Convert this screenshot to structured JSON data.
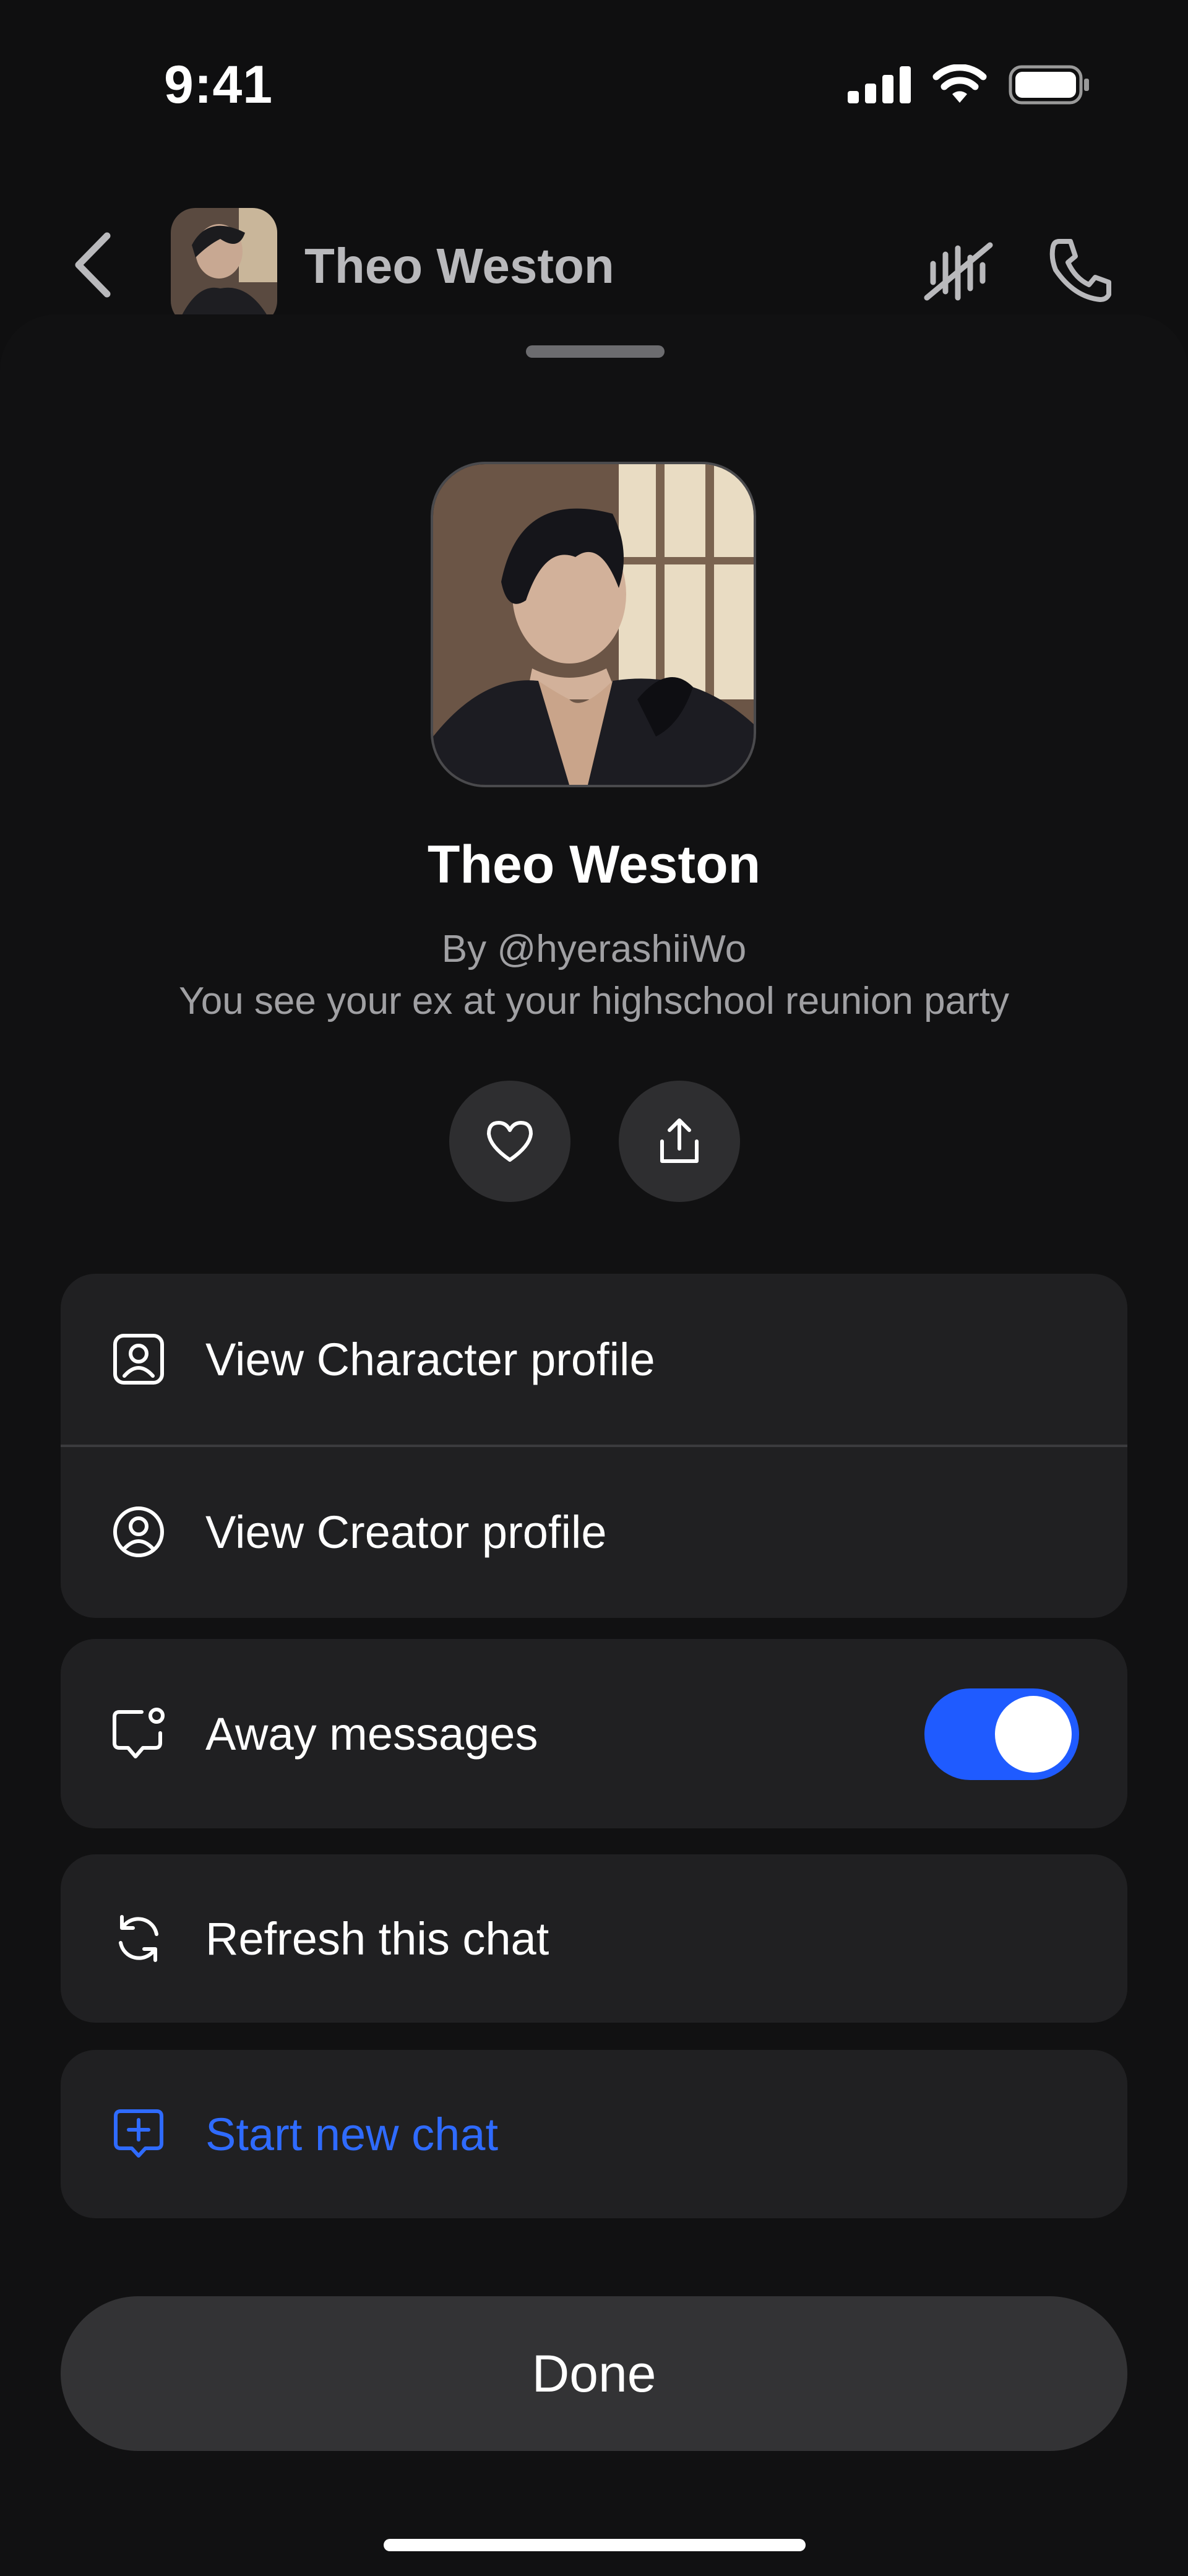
{
  "status_bar": {
    "time": "9:41"
  },
  "chat_header": {
    "name": "Theo Weston"
  },
  "profile": {
    "name": "Theo Weston",
    "creator": "By @hyerashiiWo",
    "tagline": "You see your ex at your highschool reunion party"
  },
  "actions": {
    "like_icon": "heart-icon",
    "share_icon": "share-icon"
  },
  "menu": {
    "view_character_profile": "View Character profile",
    "view_creator_profile": "View Creator profile",
    "away_messages": "Away messages",
    "away_messages_enabled": true,
    "refresh_chat": "Refresh this chat",
    "start_new_chat": "Start new chat"
  },
  "done_label": "Done",
  "colors": {
    "accent": "#1f5bff",
    "link": "#2f6bff",
    "card": "#202022",
    "background": "#0f0f10"
  }
}
